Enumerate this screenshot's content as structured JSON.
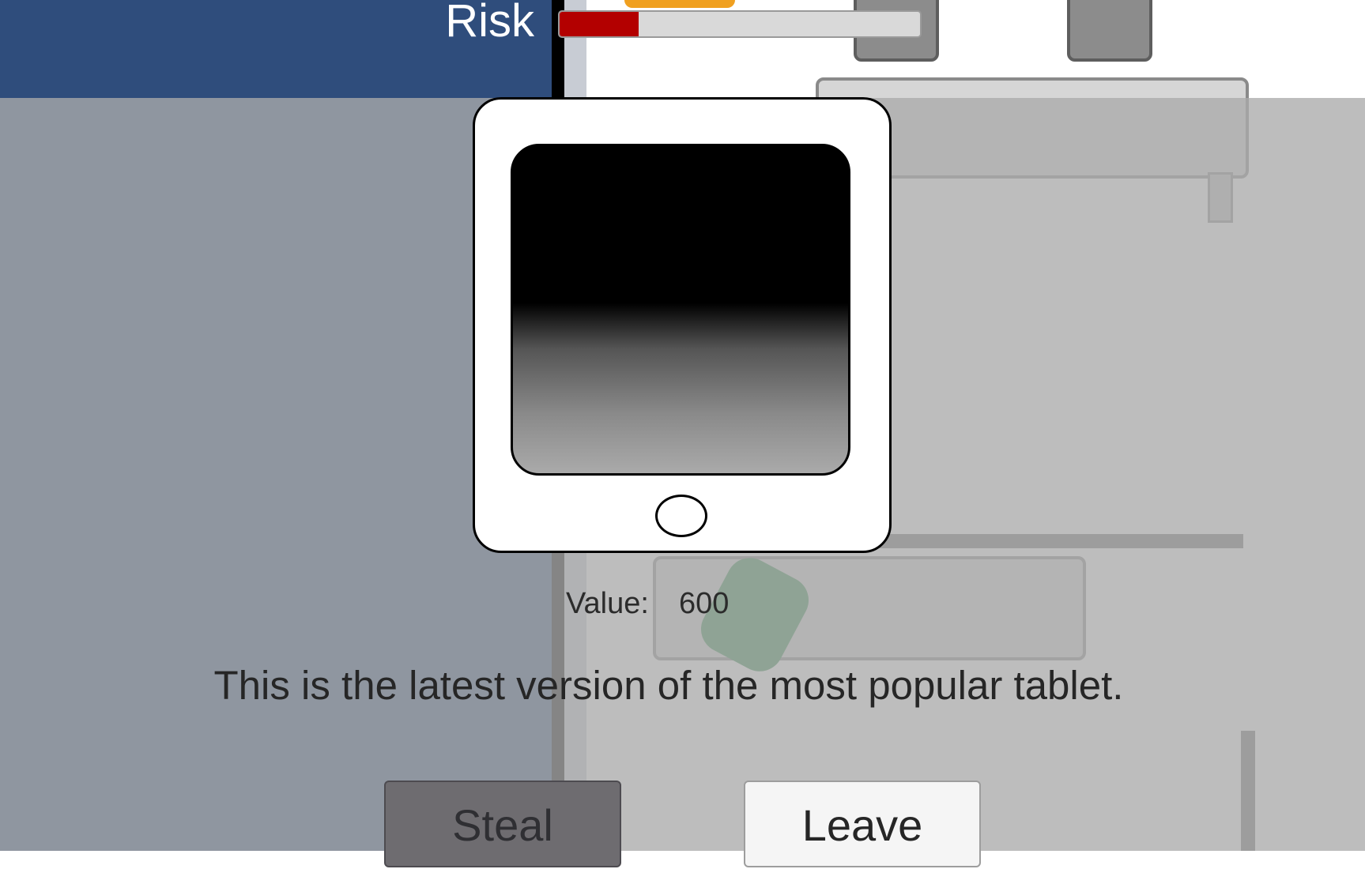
{
  "hud": {
    "risk_label": "Risk",
    "risk_level_fraction": 0.22,
    "risk_color": "#b30000"
  },
  "item_popup": {
    "item_icon": "tablet-icon",
    "value_label": "Value:",
    "value": "600",
    "description": "This is the latest version of the most popular tablet.",
    "steal_label": "Steal",
    "leave_label": "Leave"
  },
  "colors": {
    "left_panel": "#2f4d7c",
    "overlay": "#aaaaaa"
  }
}
